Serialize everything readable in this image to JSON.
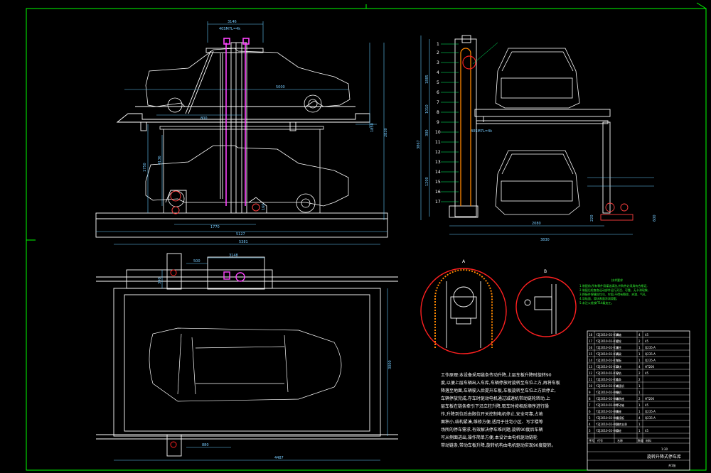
{
  "drawing": {
    "background": "#000000",
    "colors": {
      "border": "#00ff00",
      "outline": "#ffffff",
      "dimension": "#66ccff",
      "column": "#ff44ff",
      "detail_circle": "#ff2020",
      "chain": "#ff8800",
      "accent": "#00ff66"
    }
  },
  "front_view": {
    "dims": {
      "top_width": "3146",
      "spec": "40SM7L=4k",
      "car_length": "5000",
      "platform_offset": "800",
      "left_height": "1850",
      "right_height": "2830",
      "mid_height": "1750",
      "small_height": "4136",
      "bottom_inner": "1770",
      "bottom_total": "5127",
      "right_small": "160"
    }
  },
  "side_view": {
    "dims": {
      "total_height": "3867",
      "seg_1": "1885",
      "seg_2": "1010",
      "seg_3": "300",
      "seg_4": "1200",
      "spec": "40SM7L=4k",
      "bottom_inner": "2080",
      "bottom_total": "3830",
      "right_a": "220",
      "right_b": "600"
    },
    "callouts": [
      "1",
      "2",
      "3",
      "4",
      "5",
      "6",
      "7",
      "8",
      "9",
      "10",
      "11",
      "12",
      "13",
      "14",
      "15",
      "16",
      "17"
    ]
  },
  "plan_view": {
    "dims": {
      "top_total": "5381",
      "top_inner": "3148",
      "small_width": "500",
      "small_height": "340",
      "right_height": "3000",
      "bottom_small": "880",
      "bottom_total": "4487"
    }
  },
  "details": {
    "label_a": "A",
    "label_b": "B"
  },
  "requirements": {
    "title": "技术要求",
    "lines": [
      "1.装配前,所有零件用煤油清洗,外购件必须具有合格证,",
      "2.装配后检查各运动部件运行灵活、可靠、无卡滞现象,",
      "3.焊接件焊缝应均匀、牢固,不得有裂纹、夹渣、气孔,",
      "4.导轨面、滑块表面涂润滑脂,",
      "5.未注公差按IT14级加工。"
    ]
  },
  "work_principle": {
    "lines": [
      "工作原理:本设备采用链条传动升降,上层车板升降时旋转90",
      "度,以便上层车辆出入车库,车辆停放时旋转至车位上方,再将车板",
      "降落至地面,车辆驶入后提升车板,车板旋转至车位上方后停止,",
      "车辆停放完成,存车时驱动电机通过减速机带动链轮转动,上",
      "层车板在链条牵引下沿立柱升降,取车时按相反顺序进行操",
      "作,升降到位后由限位开关控制电机停止,安全可靠,占地",
      "面积小,结构紧凑,维修方便,适用于住宅小区、写字楼等",
      "场所的停车需求,有效解决停车难问题,旋转90度后车辆",
      "可从侧面进出,操作简单方便,本设计由电机驱动链轮",
      "带动链条,带动车板升降,旋转机构由电机驱动实现90度旋转。"
    ]
  },
  "bom": {
    "rows": [
      [
        "18",
        "YZJ2010-02-018",
        "销轴",
        "4",
        "45"
      ],
      [
        "17",
        "YZJ2010-02-017",
        "链轮",
        "2",
        "45"
      ],
      [
        "16",
        "YZJ2010-02-016",
        "立柱",
        "1",
        "Q235-A"
      ],
      [
        "15",
        "YZJ2010-02-015",
        "横梁",
        "1",
        "Q235-A"
      ],
      [
        "14",
        "YZJ2010-02-014",
        "车板",
        "1",
        "Q235-A"
      ],
      [
        "13",
        "YZJ2010-02-013",
        "滑块",
        "4",
        "HT200"
      ],
      [
        "12",
        "YZJ2010-02-012",
        "导轨",
        "2",
        "45"
      ],
      [
        "11",
        "YZJ2010-02-011",
        "链条",
        "2",
        ""
      ],
      [
        "10",
        "YZJ2010-02-010",
        "减速机",
        "1",
        ""
      ],
      [
        "9",
        "YZJ2010-02-009",
        "电机",
        "1",
        ""
      ],
      [
        "8",
        "YZJ2010-02-008",
        "轴承座",
        "2",
        "HT200"
      ],
      [
        "7",
        "YZJ2010-02-007",
        "传动轴",
        "1",
        "45"
      ],
      [
        "6",
        "YZJ2010-02-006",
        "底座",
        "1",
        "Q235-A"
      ],
      [
        "5",
        "YZJ2010-02-005",
        "连接板",
        "4",
        "Q235-A"
      ],
      [
        "4",
        "YZJ2010-02-004",
        "回转支承",
        "1",
        ""
      ],
      [
        "3",
        "YZJ2010-02-003",
        "齿轮",
        "1",
        "45"
      ],
      [
        "2",
        "YZJ2010-02-002",
        "支架",
        "2",
        "Q235-A"
      ],
      [
        "1",
        "YZJ2010-02-001",
        "地脚螺栓",
        "8",
        "Q235-A"
      ]
    ],
    "header": [
      "序号",
      "代号",
      "名称",
      "数量",
      "材料"
    ]
  },
  "title_block": {
    "drawing_name": "旋转升降式停车库",
    "scale": "1:30",
    "sheet": "共1张"
  }
}
